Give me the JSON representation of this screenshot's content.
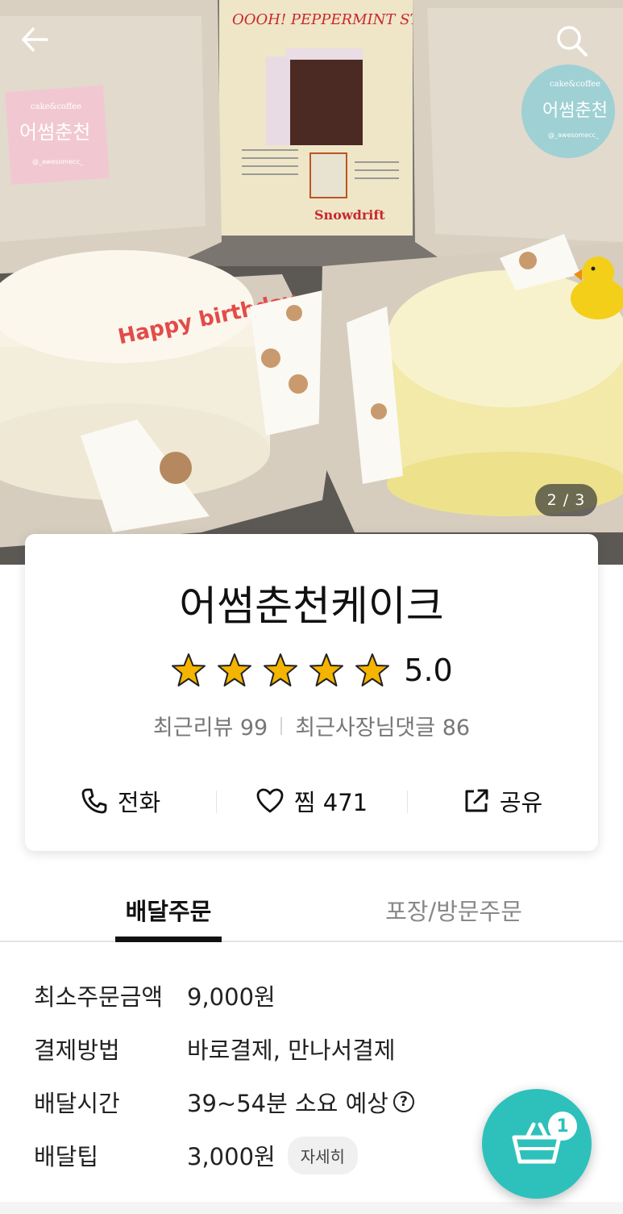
{
  "hero": {
    "page_indicator": "2 / 3",
    "icons": {
      "back": "arrow-left-icon",
      "search": "search-icon"
    },
    "photo_text": {
      "left_sticker_top": "cake&coffee",
      "left_sticker_main": "어썸춘천",
      "left_sticker_handle": "@_awesomecc_",
      "right_sticker_top": "cake&coffee",
      "right_sticker_main": "어썸춘천",
      "right_sticker_handle": "@_awesomecc_",
      "poster_title": "OOOH! PEPPERMINT STICK CAKE",
      "poster_brand": "Snowdrift",
      "cake_text": "Happy birthday"
    }
  },
  "store": {
    "name": "어썸춘천케이크",
    "rating": "5.0",
    "star_count": 5,
    "reviews": "최근리뷰 99",
    "owner_replies": "최근사장님댓글 86"
  },
  "actions": {
    "call": "전화",
    "like": "찜 471",
    "share": "공유"
  },
  "tabs": {
    "delivery": "배달주문",
    "pickup": "포장/방문주문"
  },
  "info": {
    "min_order_label": "최소주문금액",
    "min_order_value": "9,000원",
    "payment_label": "결제방법",
    "payment_value": "바로결제, 만나서결제",
    "time_label": "배달시간",
    "time_value": "39~54분 소요 예상",
    "tip_label": "배달팁",
    "tip_value": "3,000원",
    "detail_button": "자세히"
  },
  "cart": {
    "count": "1"
  },
  "colors": {
    "accent": "#2ec1bb",
    "star": "#f5b400"
  }
}
